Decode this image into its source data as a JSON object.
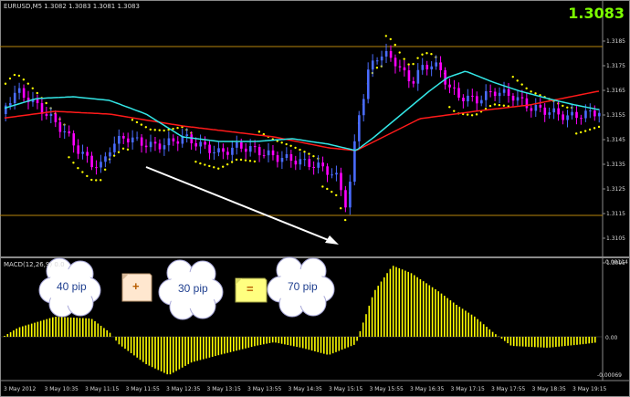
{
  "header": {
    "symbol_label": "EURUSD,M5  1.3082 1.3083 1.3081 1.3083",
    "current_price": "1.3083"
  },
  "colors": {
    "bull": "#4a6cff",
    "bear": "#ff00ff",
    "ma_slow": "#ff1a1a",
    "ma_fast": "#33e6e6",
    "sar": "#ffff00",
    "macd": "#ffff00",
    "hline": "#b8860b",
    "arrow": "#ffffff"
  },
  "price_axis": {
    "labels": [
      "1.3185",
      "1.3175",
      "1.3165",
      "1.3155",
      "1.3145",
      "1.3135",
      "1.3125",
      "1.3115",
      "1.3105",
      "1.3095"
    ]
  },
  "time_axis": {
    "labels": [
      "3 May 2012",
      "3 May 10:35",
      "3 May 11:15",
      "3 May 11:55",
      "3 May 12:35",
      "3 May 13:15",
      "3 May 13:55",
      "3 May 14:35",
      "3 May 15:15",
      "3 May 15:55",
      "3 May 16:35",
      "3 May 17:15",
      "3 May 17:55",
      "3 May 18:35",
      "3 May 19:15"
    ]
  },
  "macd_panel": {
    "name": "MACD(12,26,9) 0.0",
    "axis_labels": [
      "0.00114",
      "0.00",
      "-0.00069"
    ]
  },
  "annotation": {
    "cloud1": "40 pip",
    "plus": "+",
    "cloud2": "30 pip",
    "equals": "=",
    "cloud3": "70 pip"
  }
}
